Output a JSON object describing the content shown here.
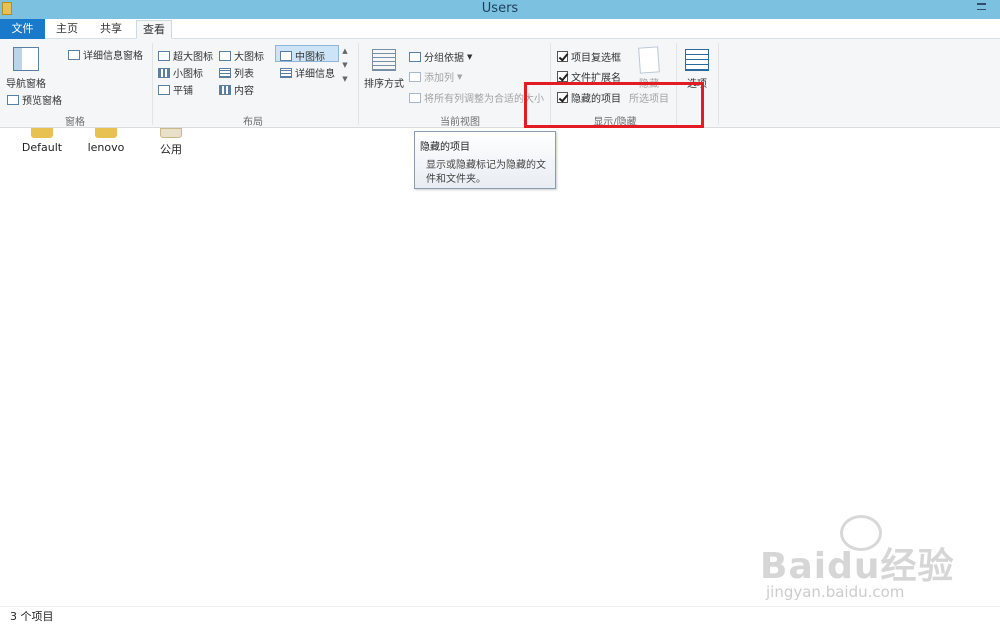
{
  "window": {
    "title": "Users"
  },
  "tabs": {
    "file": "文件",
    "home": "主页",
    "share": "共享",
    "view": "查看"
  },
  "ribbon": {
    "panes": {
      "nav_pane": "导航窗格",
      "preview_pane": "预览窗格",
      "details_pane": "详细信息窗格",
      "label": "窗格"
    },
    "layout": {
      "extra_large": "超大图标",
      "large": "大图标",
      "medium": "中图标",
      "small": "小图标",
      "list": "列表",
      "details": "详细信息",
      "tiles": "平铺",
      "content": "内容",
      "label": "布局"
    },
    "current_view": {
      "sort_by": "排序方式",
      "group_by": "分组依据",
      "add_columns": "添加列",
      "size_columns": "将所有列调整为合适的大小",
      "label": "当前视图"
    },
    "show_hide": {
      "item_checkboxes": "项目复选框",
      "file_extensions": "文件扩展名",
      "hidden_items": "隐藏的项目",
      "hide_selected": "隐藏",
      "selected_items": "所选项目",
      "label": "显示/隐藏",
      "item_checkboxes_checked": true,
      "file_extensions_checked": true,
      "hidden_items_checked": true
    },
    "options": "选项"
  },
  "tooltip": {
    "title": "隐藏的项目",
    "body": "显示或隐藏标记为隐藏的文件和文件夹。"
  },
  "folders": [
    "Default",
    "lenovo",
    "公用"
  ],
  "status": {
    "count": "3 个项目"
  },
  "colors": {
    "accent": "#1979ca",
    "titlebar": "#7cc1e0",
    "highlight": "#e31c23"
  },
  "watermark": {
    "brand": "Baidu经验",
    "url": "jingyan.baidu.com"
  }
}
